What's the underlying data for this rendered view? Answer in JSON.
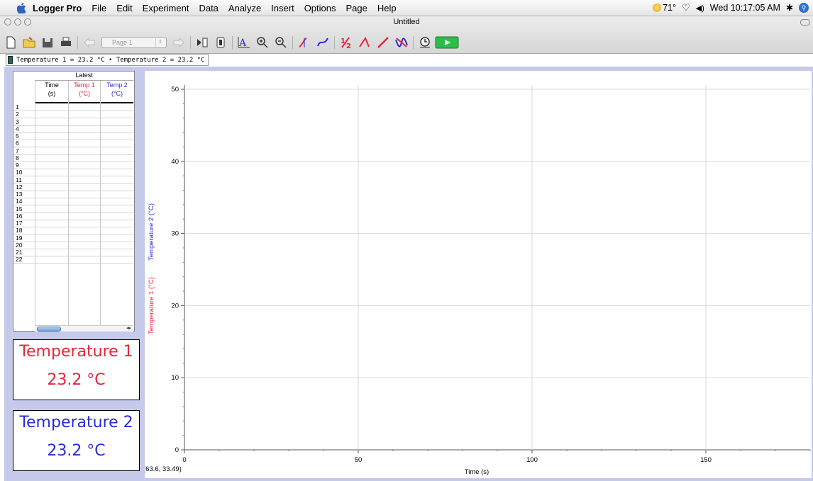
{
  "menubar": {
    "app_name": "Logger Pro",
    "items": [
      "File",
      "Edit",
      "Experiment",
      "Data",
      "Analyze",
      "Insert",
      "Options",
      "Page",
      "Help"
    ],
    "weather": "71°",
    "clock": "Wed 10:17:05 AM"
  },
  "window": {
    "title": "Untitled",
    "page_select": "Page 1"
  },
  "status": {
    "text": "Temperature 1 =  23.2 °C • Temperature 2 =  23.2 °C"
  },
  "table": {
    "dataset": "Latest",
    "columns": [
      {
        "name": "Time",
        "unit": "(s)",
        "color": "#000000"
      },
      {
        "name": "Temp 1",
        "unit": "(°C)",
        "color": "#e8243c"
      },
      {
        "name": "Temp 2",
        "unit": "(°C)",
        "color": "#2b2bd9"
      }
    ],
    "row_numbers": [
      "1",
      "2",
      "3",
      "4",
      "5",
      "6",
      "7",
      "8",
      "9",
      "10",
      "11",
      "12",
      "13",
      "14",
      "15",
      "16",
      "17",
      "18",
      "19",
      "20",
      "21",
      "22"
    ]
  },
  "meters": [
    {
      "label": "Temperature 1",
      "value": "23.2 °C",
      "color": "#e8243c"
    },
    {
      "label": "Temperature 2",
      "value": "23.2 °C",
      "color": "#2b2bd9"
    }
  ],
  "graph": {
    "xlabel": "Time (s)",
    "ylabel_1": "Temperature 1 (°C)",
    "ylabel_2": "Temperature 2 (°C)",
    "ylabel_1_color": "#e8243c",
    "ylabel_2_color": "#2b2bd9",
    "coord_readout": "(63.6, 33.49)"
  },
  "chart_data": {
    "type": "line",
    "title": "",
    "xlabel": "Time (s)",
    "ylabel": "Temperature 1 (°C)  Temperature 2 (°C)",
    "xlim": [
      0,
      180
    ],
    "ylim": [
      0,
      50
    ],
    "x_ticks": [
      0,
      50,
      100,
      150
    ],
    "y_ticks": [
      0,
      10,
      20,
      30,
      40,
      50
    ],
    "grid": true,
    "series": []
  }
}
